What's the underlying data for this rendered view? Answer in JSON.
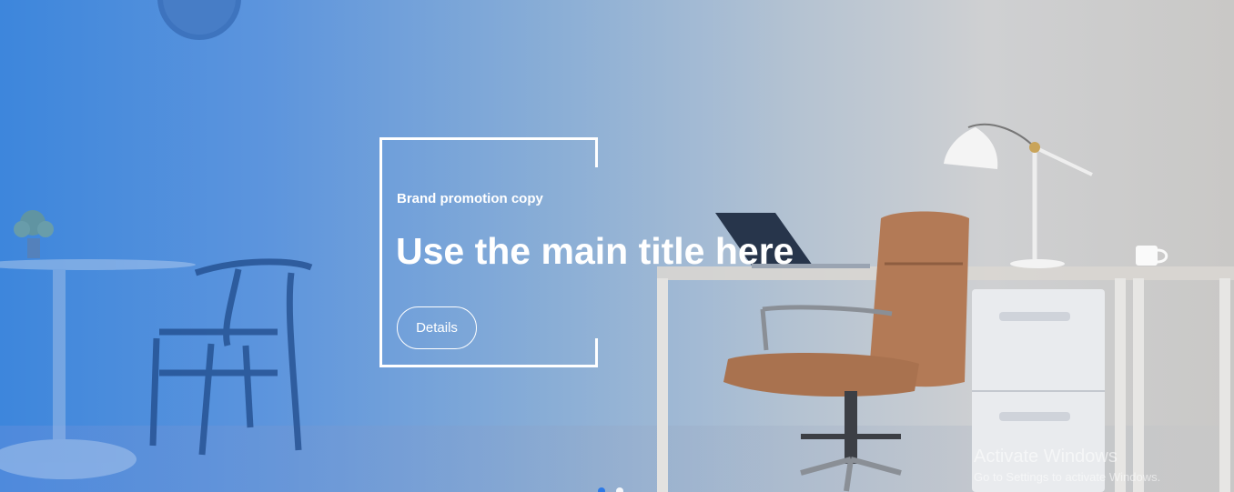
{
  "hero": {
    "promo_copy": "Brand promotion copy",
    "main_title": "Use the main title here",
    "details_label": "Details"
  },
  "carousel": {
    "slide_count": 2,
    "active_index": 0
  },
  "watermark": {
    "title": "Activate Windows",
    "subtitle": "Go to Settings to activate Windows."
  },
  "colors": {
    "accent": "#2d79e6",
    "gradient_left": "#3d86dc",
    "gradient_right": "#c9c8c6"
  }
}
